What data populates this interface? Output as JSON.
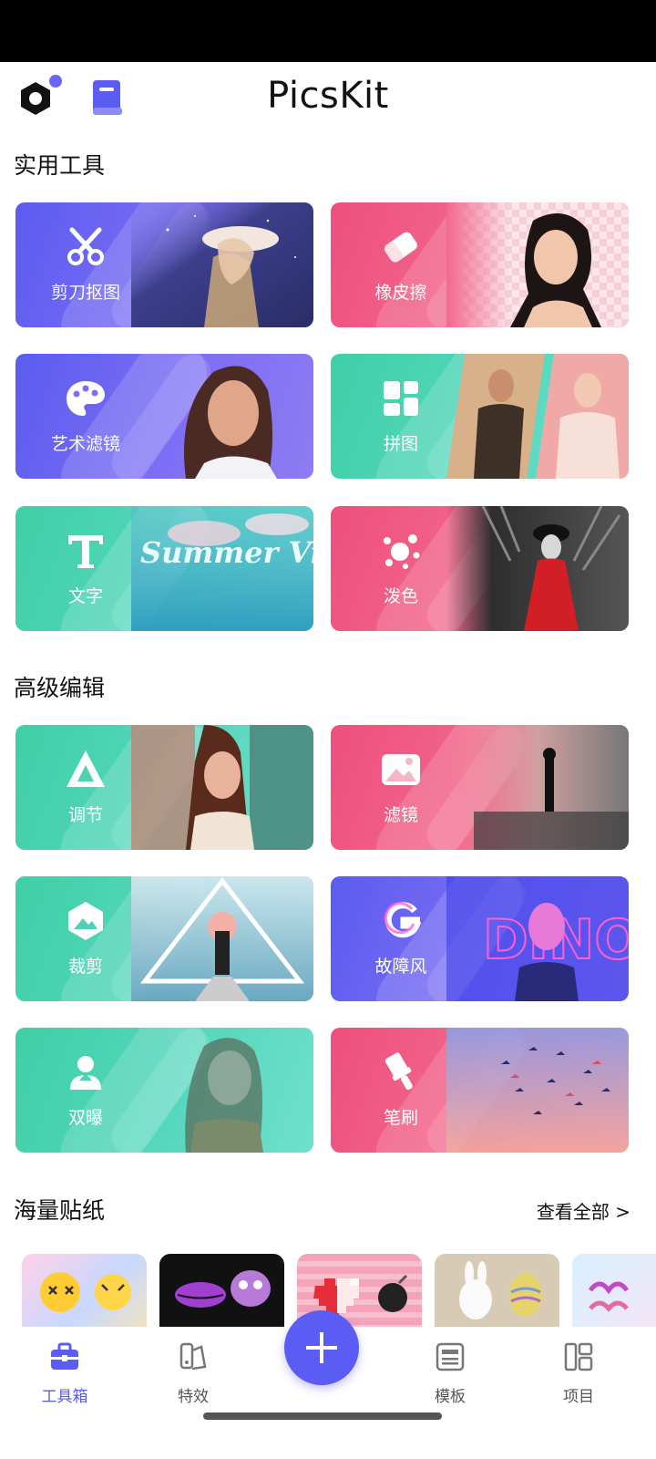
{
  "header": {
    "title": "PicsKit"
  },
  "sections": {
    "tools_title": "实用工具",
    "advanced_title": "高级编辑",
    "stickers_title": "海量贴纸",
    "see_all": "查看全部 >"
  },
  "tools": [
    {
      "label": "剪刀抠图",
      "icon": "scissors-icon"
    },
    {
      "label": "橡皮擦",
      "icon": "eraser-icon"
    },
    {
      "label": "艺术滤镜",
      "icon": "palette-icon"
    },
    {
      "label": "拼图",
      "icon": "collage-icon"
    },
    {
      "label": "文字",
      "icon": "text-icon"
    },
    {
      "label": "泼色",
      "icon": "splash-icon"
    }
  ],
  "advanced": [
    {
      "label": "调节",
      "icon": "adjust-icon"
    },
    {
      "label": "滤镜",
      "icon": "filter-icon"
    },
    {
      "label": "裁剪",
      "icon": "crop-icon"
    },
    {
      "label": "故障风",
      "icon": "glitch-icon"
    },
    {
      "label": "双曝",
      "icon": "double-exposure-icon"
    },
    {
      "label": "笔刷",
      "icon": "brush-icon"
    }
  ],
  "tool_card_text": {
    "summer_vibe": "Summer Vibe"
  },
  "stickers": [
    {
      "name": "emoji-sticker-pack"
    },
    {
      "name": "lips-sticker-pack"
    },
    {
      "name": "pixel-heart-sticker-pack"
    },
    {
      "name": "easter-bunny-sticker-pack"
    },
    {
      "name": "happy-easter-sticker-pack"
    }
  ],
  "bottom_nav": {
    "items": [
      {
        "label": "工具箱",
        "icon": "toolbox-icon",
        "active": true
      },
      {
        "label": "特效",
        "icon": "effects-icon",
        "active": false
      },
      {
        "label": "模板",
        "icon": "template-icon",
        "active": false
      },
      {
        "label": "项目",
        "icon": "project-icon",
        "active": false
      }
    ],
    "fab_icon": "plus-icon"
  },
  "colors": {
    "accent": "#5b5cf3",
    "purple_card": "#6b64f2",
    "pink_card": "#f05b85",
    "teal_card": "#4cd4b2"
  }
}
